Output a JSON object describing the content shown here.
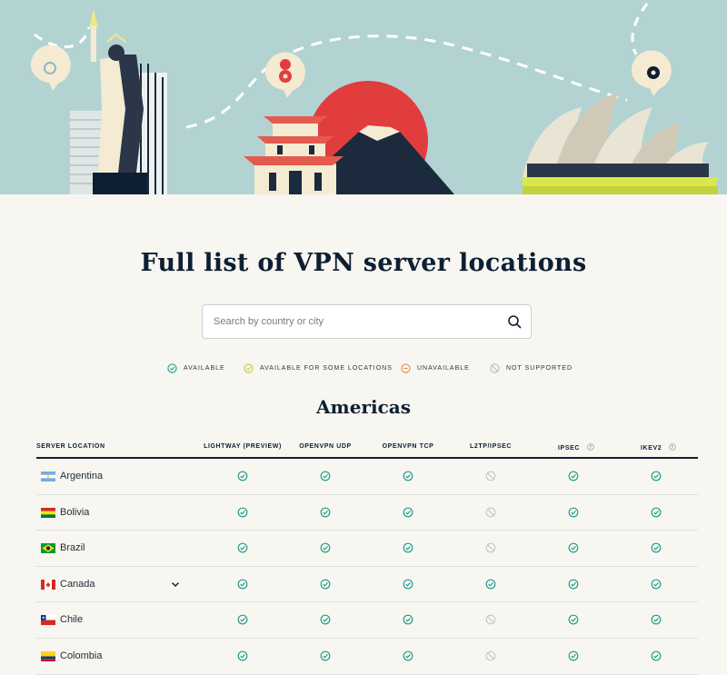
{
  "page": {
    "title": "Full list of VPN server locations",
    "search_placeholder": "Search by country or city"
  },
  "legend": [
    {
      "label": "AVAILABLE",
      "icon": "check-circle-icon",
      "color": "#1f9e8e"
    },
    {
      "label": "AVAILABLE FOR SOME LOCATIONS",
      "icon": "check-circle-partial-icon",
      "color": "#c4c92b"
    },
    {
      "label": "UNAVAILABLE",
      "icon": "minus-circle-icon",
      "color": "#e58d43"
    },
    {
      "label": "NOT SUPPORTED",
      "icon": "prohibited-icon",
      "color": "#b9b9b9"
    }
  ],
  "section": {
    "title": "Americas",
    "columns": [
      "SERVER LOCATION",
      "LIGHTWAY (PREVIEW)",
      "OPENVPN UDP",
      "OPENVPN TCP",
      "L2TP/IPSEC",
      "IPSEC",
      "IKEV2"
    ],
    "rows": [
      {
        "country": "Argentina",
        "flag": "argentina",
        "expandable": false,
        "status": [
          "available",
          "available",
          "available",
          "not_supported",
          "available",
          "available"
        ]
      },
      {
        "country": "Bolivia",
        "flag": "bolivia",
        "expandable": false,
        "status": [
          "available",
          "available",
          "available",
          "not_supported",
          "available",
          "available"
        ]
      },
      {
        "country": "Brazil",
        "flag": "brazil",
        "expandable": false,
        "status": [
          "available",
          "available",
          "available",
          "not_supported",
          "available",
          "available"
        ]
      },
      {
        "country": "Canada",
        "flag": "canada",
        "expandable": true,
        "status": [
          "available",
          "available",
          "available",
          "available",
          "available",
          "available"
        ]
      },
      {
        "country": "Chile",
        "flag": "chile",
        "expandable": false,
        "status": [
          "available",
          "available",
          "available",
          "not_supported",
          "available",
          "available"
        ]
      },
      {
        "country": "Colombia",
        "flag": "colombia",
        "expandable": false,
        "status": [
          "available",
          "available",
          "available",
          "not_supported",
          "available",
          "available"
        ]
      }
    ]
  },
  "colors": {
    "hero_sky": "#b3d3d3",
    "page_bg": "#f8f6f0",
    "navy": "#0d1f33",
    "available": "#1f9e8e",
    "not_supported": "#c4c4c4",
    "accent_red": "#e23d3e",
    "accent_yellow": "#d8e84a"
  }
}
